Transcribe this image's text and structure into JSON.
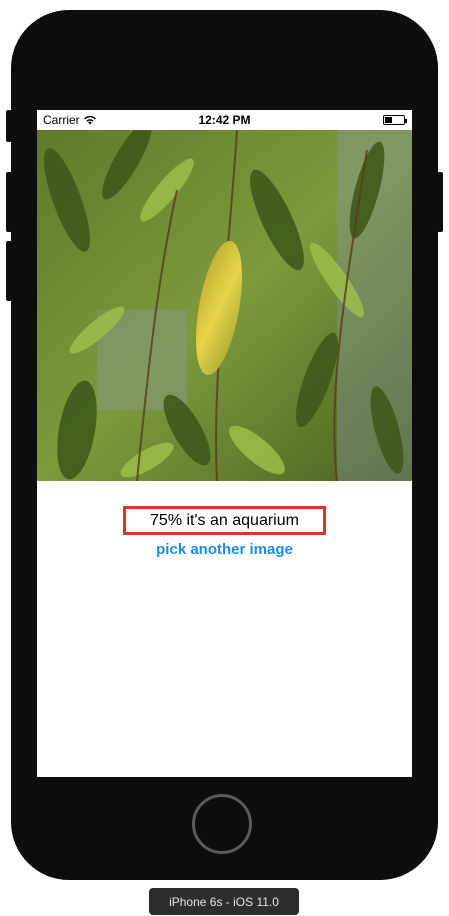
{
  "status_bar": {
    "carrier": "Carrier",
    "time": "12:42 PM",
    "wifi_icon": "wifi-icon",
    "battery_icon": "battery-icon"
  },
  "photo": {
    "description_icon": "plant-leaves-photo"
  },
  "result": {
    "text": "75% it's an aquarium",
    "border_color": "#e53229"
  },
  "actions": {
    "pick_label": "pick another image",
    "link_color": "#1a8df0"
  },
  "simulator": {
    "label": "iPhone 6s - iOS 11.0"
  }
}
